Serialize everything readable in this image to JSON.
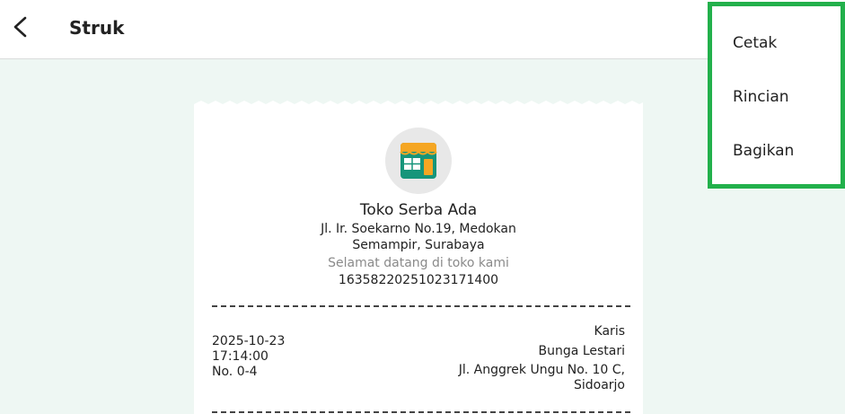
{
  "header": {
    "title": "Struk"
  },
  "receipt": {
    "store_name": "Toko Serba Ada",
    "address_line1": "Jl. Ir. Soekarno No.19, Medokan",
    "address_line2": "Semampir, Surabaya",
    "welcome": "Selamat datang di toko kami",
    "receipt_id": "16358220251023171400",
    "date": "2025-10-23",
    "time": "17:14:00",
    "number": "No. 0-4",
    "cashier": "Karis",
    "customer_name": "Bunga Lestari",
    "customer_addr_line1": "Jl. Anggrek Ungu No. 10 C,",
    "customer_addr_line2": "Sidoarjo"
  },
  "menu": {
    "items": [
      "Cetak",
      "Rincian",
      "Bagikan"
    ]
  },
  "colors": {
    "background": "#eef7f3",
    "menu_border": "#22b04b",
    "logo_teal": "#16957a",
    "logo_orange": "#f5a623"
  },
  "icons": {
    "back": "back-arrow-icon",
    "store": "store-icon"
  }
}
